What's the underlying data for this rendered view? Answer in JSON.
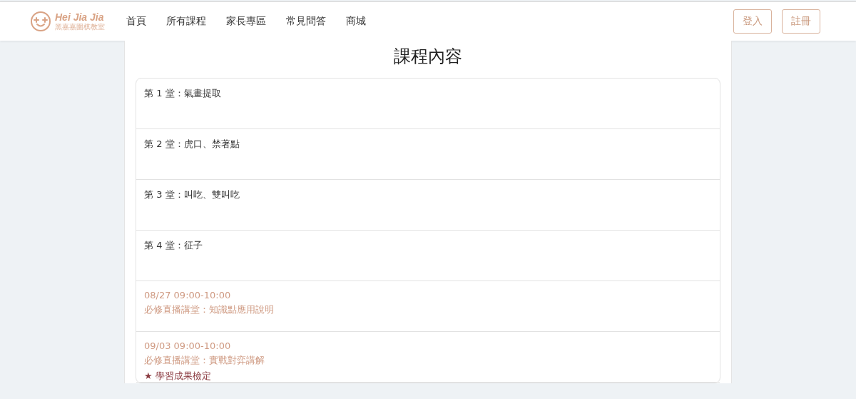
{
  "header": {
    "logo": {
      "title": "Hei Jia Jia",
      "subtitle": "黑嘉嘉圍棋教室"
    },
    "nav": [
      "首頁",
      "所有課程",
      "家長專區",
      "常見問答",
      "商城"
    ],
    "buttons": [
      "登入",
      "註冊"
    ]
  },
  "heading": "課程內容",
  "lessons": [
    {
      "kind": "lesson",
      "title": "第 1 堂：氣畫提取"
    },
    {
      "kind": "lesson",
      "title": "第 2 堂：虎口、禁著點"
    },
    {
      "kind": "lesson",
      "title": "第 3 堂：叫吃、雙叫吃"
    },
    {
      "kind": "lesson",
      "title": "第 4 堂：征子"
    },
    {
      "kind": "live",
      "time": "08/27 09:00-10:00",
      "title": "必修直播講堂：知識點應用說明"
    },
    {
      "kind": "live",
      "time": "09/03 09:00-10:00",
      "title": "必修直播講堂：實戰對弈講解",
      "note": "★ 學習成果檢定"
    }
  ]
}
